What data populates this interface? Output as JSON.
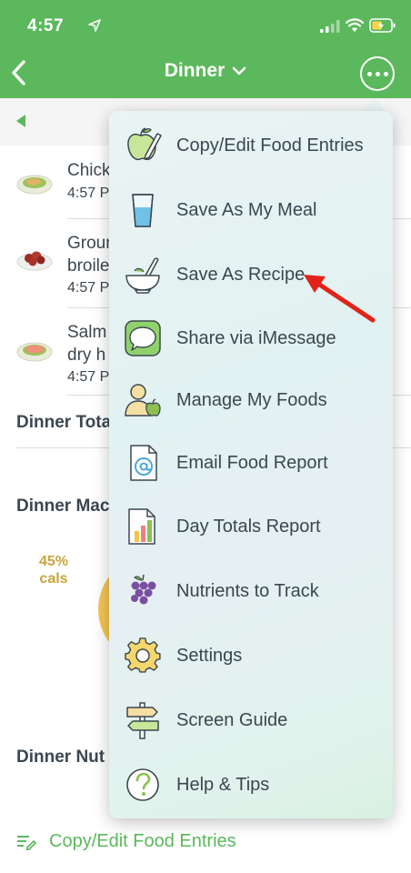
{
  "status": {
    "time": "4:57"
  },
  "nav": {
    "title": "Dinner"
  },
  "foods": [
    {
      "name_line1": "Chick",
      "name_line2": "",
      "time": "4:57 P"
    },
    {
      "name_line1": "Groun",
      "name_line2": "broile",
      "time": "4:57 P"
    },
    {
      "name_line1": "Salm",
      "name_line2": "dry h",
      "time": "4:57 P"
    }
  ],
  "sections": {
    "totals": "Dinner Tota",
    "macros": "Dinner Mac",
    "nutrients": "Dinner Nut"
  },
  "macro_chart": {
    "cals_percent": "45%",
    "cals_label": "cals"
  },
  "bottom_action": {
    "label": "Copy/Edit Food Entries"
  },
  "menu": {
    "items": [
      {
        "label": "Copy/Edit Food Entries",
        "icon": "apple-pencil-icon"
      },
      {
        "label": "Save As My Meal",
        "icon": "glass-icon"
      },
      {
        "label": "Save As Recipe",
        "icon": "mortar-pestle-icon"
      },
      {
        "label": "Share via iMessage",
        "icon": "message-bubble-icon"
      },
      {
        "label": "Manage My Foods",
        "icon": "person-apple-icon"
      },
      {
        "label": "Email Food Report",
        "icon": "email-document-icon"
      },
      {
        "label": "Day Totals Report",
        "icon": "bar-report-icon"
      },
      {
        "label": "Nutrients to Track",
        "icon": "grapes-icon"
      },
      {
        "label": "Settings",
        "icon": "gear-icon"
      },
      {
        "label": "Screen Guide",
        "icon": "signpost-icon"
      },
      {
        "label": "Help & Tips",
        "icon": "help-icon"
      }
    ]
  },
  "colors": {
    "header_green": "#5cb85c",
    "text_dark": "#3b4750",
    "annotation_red": "#e2231a",
    "cals_gold": "#c9a53c"
  }
}
